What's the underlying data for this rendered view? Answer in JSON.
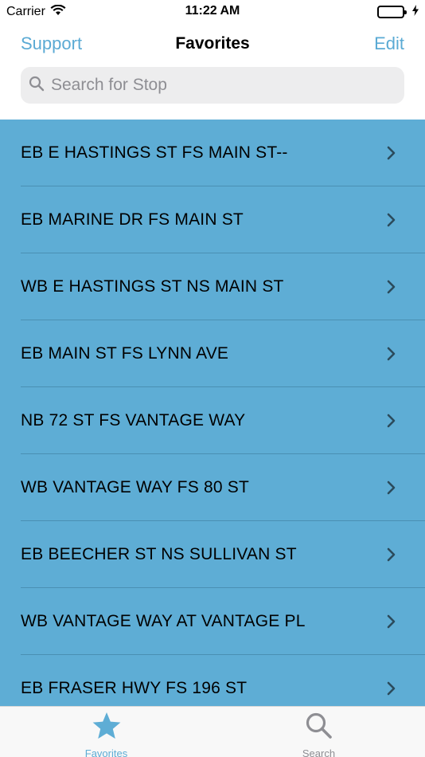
{
  "status_bar": {
    "carrier": "Carrier",
    "time": "11:22 AM"
  },
  "nav": {
    "left_label": "Support",
    "title": "Favorites",
    "right_label": "Edit"
  },
  "search": {
    "placeholder": "Search for Stop",
    "value": ""
  },
  "favorites": [
    "EB E HASTINGS ST FS MAIN ST--",
    "EB MARINE DR FS MAIN ST",
    "WB E HASTINGS ST NS MAIN ST",
    "EB MAIN ST FS LYNN AVE",
    "NB 72 ST FS VANTAGE WAY",
    "WB VANTAGE WAY FS 80 ST",
    "EB BEECHER ST NS SULLIVAN ST",
    "WB VANTAGE WAY AT VANTAGE PL",
    "EB FRASER HWY FS 196 ST"
  ],
  "tabs": [
    {
      "label": "Favorites",
      "icon": "star-icon",
      "active": true
    },
    {
      "label": "Search",
      "icon": "search-icon",
      "active": false
    }
  ],
  "colors": {
    "accent": "#5aaad4",
    "list_background": "#5eadd5",
    "inactive": "#8e8e93"
  }
}
